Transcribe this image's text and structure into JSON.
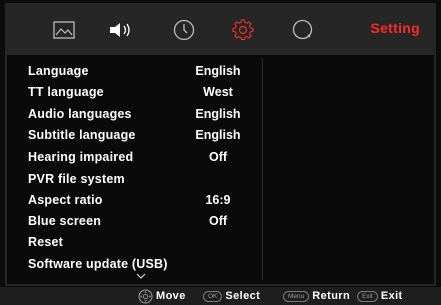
{
  "tabs": [
    {
      "icon": "picture-icon"
    },
    {
      "icon": "speaker-icon"
    },
    {
      "icon": "clock-icon"
    },
    {
      "icon": "gear-icon",
      "active": true
    },
    {
      "icon": "search-icon"
    }
  ],
  "header": {
    "title": "Setting"
  },
  "menu": [
    {
      "label": "Language",
      "value": "English"
    },
    {
      "label": "TT language",
      "value": "West"
    },
    {
      "label": "Audio languages",
      "value": "English"
    },
    {
      "label": "Subtitle language",
      "value": "English"
    },
    {
      "label": "Hearing impaired",
      "value": "Off"
    },
    {
      "label": "PVR file system",
      "value": ""
    },
    {
      "label": "Aspect ratio",
      "value": "16:9"
    },
    {
      "label": "Blue screen",
      "value": "Off"
    },
    {
      "label": "Reset",
      "value": ""
    },
    {
      "label": "Software update (USB)",
      "value": ""
    }
  ],
  "footer": {
    "move": "Move",
    "ok_key": "OK",
    "select": "Select",
    "menu_key": "Menu",
    "return": "Return",
    "exit_key": "Exit",
    "exit": "Exit"
  },
  "colors": {
    "accent": "#ff2a2a",
    "bar": "#262626",
    "background": "#0a0a0a"
  }
}
